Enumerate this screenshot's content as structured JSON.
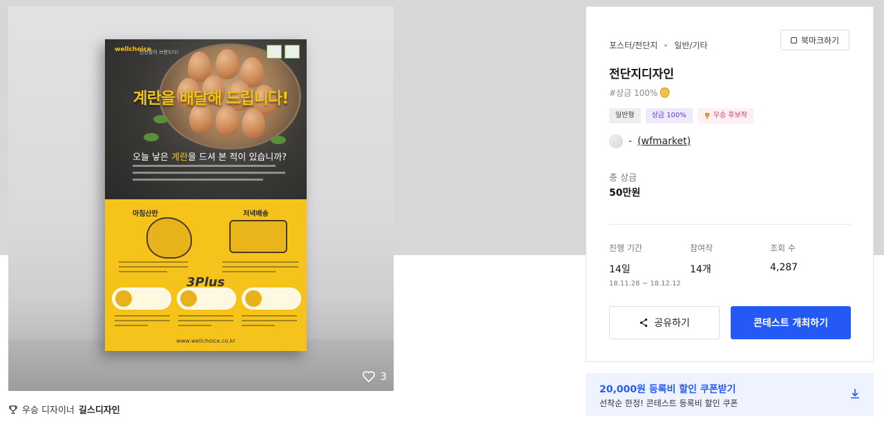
{
  "gallery": {
    "like_count": "3",
    "poster": {
      "brand": "wellchoice",
      "tagline": "신선함이 브랜드다!",
      "headline": "계란을 배달해 드립니다!",
      "subhead_prefix": "오늘 낳은 ",
      "subhead_em": "계란",
      "subhead_suffix": "을 드셔 본 적이 있습니까?",
      "label_morning": "아침산란",
      "label_evening": "저녁배송",
      "plus_label": "3Plus",
      "url": "www.wellchoice.co.kr"
    }
  },
  "designer": {
    "label": "우승 디자이너",
    "name": "길스디자인"
  },
  "contest": {
    "breadcrumb": [
      "포스터/전단지",
      "일반/기타"
    ],
    "bookmark_label": "북마크하기",
    "title": "전단지디자인",
    "prize_note": "#상금 100%",
    "tags": [
      "일반형",
      "상금 100%",
      "우승 후보작"
    ],
    "host_prefix": "-",
    "host_id": "(wfmarket)",
    "total_prize_label": "총 상금",
    "total_prize_value": "50만원",
    "stats": {
      "period_label": "진행 기간",
      "period_value": "14일",
      "period_range": "18.11.28 ~ 18.12.12",
      "entries_label": "참여작",
      "entries_value": "14개",
      "views_label": "조회 수",
      "views_value": "4,287"
    },
    "share_label": "공유하기",
    "host_button_label": "콘테스트 개최하기"
  },
  "coupon": {
    "title": "20,000원 등록비 할인 쿠폰받기",
    "subtitle": "선착순 한정! 콘테스트 등록비 할인 쿠폰"
  },
  "colors": {
    "accent": "#2559f5",
    "poster_yellow": "#f5c31a"
  }
}
